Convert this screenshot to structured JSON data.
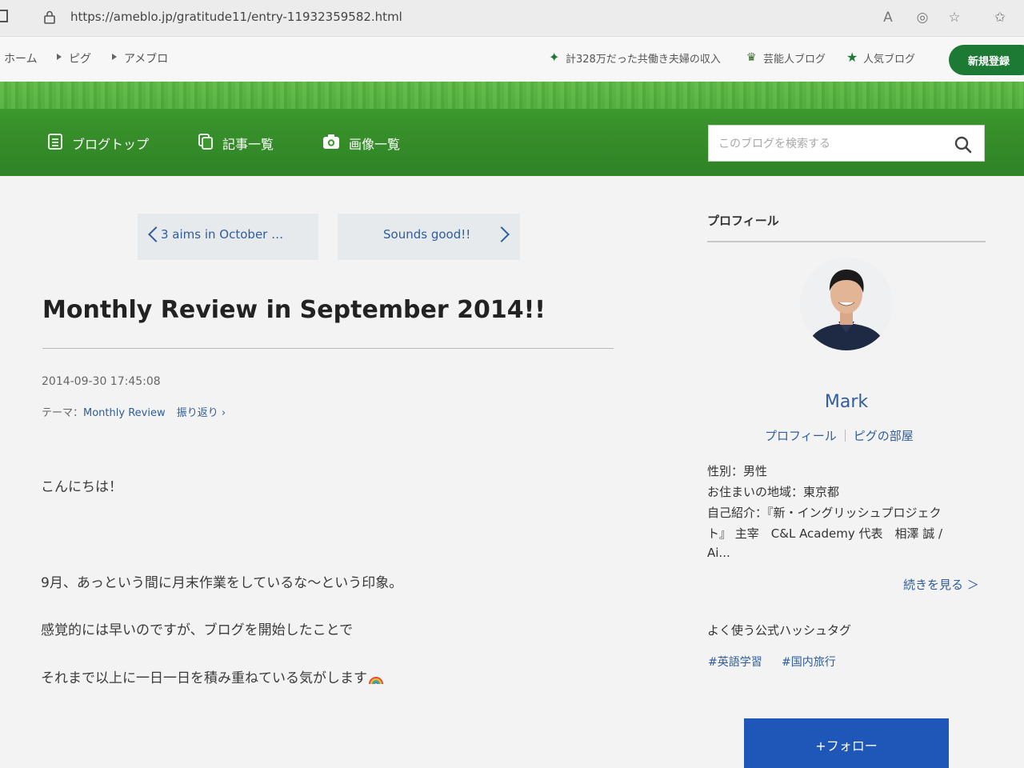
{
  "browser": {
    "url": "https://ameblo.jp/gratitude11/entry-11932359582.html",
    "icons": [
      "home-icon",
      "lock-icon",
      "read-aloud-icon",
      "tracking-prevention-icon",
      "add-favorite-icon",
      "favorites-icon"
    ]
  },
  "header": {
    "breadcrumbs": [
      "ホーム",
      "ピグ",
      "アメブロ"
    ],
    "links": [
      {
        "label": "計328万だった共働き夫婦の収入",
        "icon": "sparkle-icon"
      },
      {
        "label": "芸能人ブログ",
        "icon": "crown-icon"
      },
      {
        "label": "人気ブログ",
        "icon": "star-icon"
      }
    ],
    "signup_label": "新規登録"
  },
  "blog_nav": {
    "items": [
      {
        "label": "ブログトップ",
        "icon": "document-icon"
      },
      {
        "label": "記事一覧",
        "icon": "copy-icon"
      },
      {
        "label": "画像一覧",
        "icon": "camera-icon"
      }
    ],
    "search_placeholder": "このブログを検索する"
  },
  "article": {
    "prev_title": "3 aims in October …",
    "next_title": "Sounds good!!",
    "title": "Monthly Review in September 2014!!",
    "date": "2014-09-30 17:45:08",
    "theme_label": "テーマ：",
    "theme_name": "Monthly Review",
    "theme_tag": "振り返り",
    "body": [
      "こんにちは！",
      "9月、あっという間に月末作業をしているな～という印象。",
      "感覚的には早いのですが、ブログを開始したことで",
      "それまで以上に一日一日を積み重ねている気がします"
    ]
  },
  "sidebar": {
    "heading": "プロフィール",
    "name": "Mark",
    "links": [
      "プロフィール",
      "ピグの部屋"
    ],
    "details": [
      "性別：男性",
      "お住まいの地域：東京都",
      "自己紹介：『新・イングリッシュプロジェク",
      "ト』 主宰　C&L Academy 代表　相澤 誠 /",
      "Ai..."
    ],
    "more_label": "続きを見る ＞",
    "hashtags_title": "よく使う公式ハッシュタグ",
    "hashtags": [
      "#英語学習",
      "#国内旅行"
    ],
    "follow_label": "+フォロー"
  },
  "colors": {
    "banner_green": "#3e9a2e",
    "link_blue": "#2f5d9d",
    "follow_blue": "#1f57b8",
    "signup_green": "#1d7a35"
  }
}
